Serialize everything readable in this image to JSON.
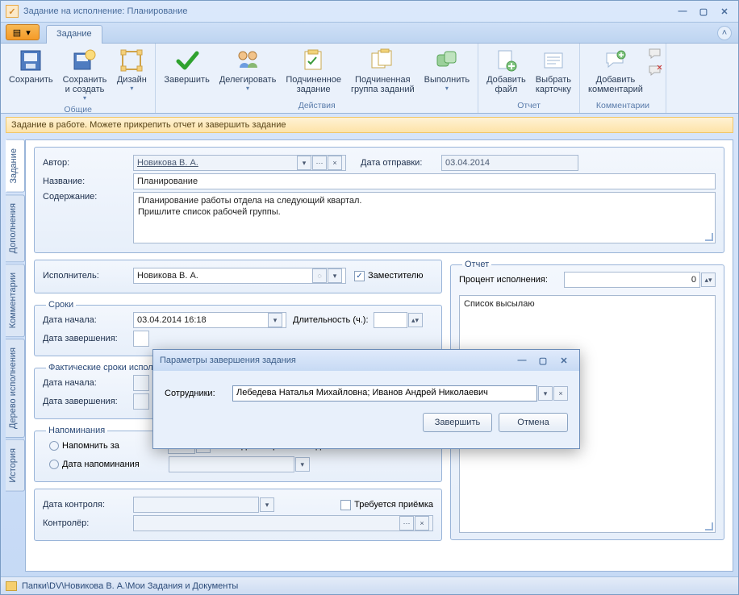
{
  "window": {
    "title": "Задание на исполнение: Планирование"
  },
  "tabs": {
    "main": "Задание"
  },
  "ribbon": {
    "groups": {
      "common": "Общие",
      "actions": "Действия",
      "report": "Отчет",
      "comments": "Комментарии"
    },
    "save": "Сохранить",
    "save_create": "Сохранить\nи создать",
    "design": "Дизайн",
    "finish": "Завершить",
    "delegate": "Делегировать",
    "sub_task": "Подчиненное\nзадание",
    "sub_group": "Подчиненная\nгруппа заданий",
    "execute": "Выполнить",
    "add_file": "Добавить\nфайл",
    "pick_card": "Выбрать\nкарточку",
    "add_comment": "Добавить\nкомментарий"
  },
  "message": "Задание в работе. Можете прикрепить отчет и завершить задание",
  "sidetabs": {
    "task": "Задание",
    "extra": "Дополнения",
    "comments": "Комментарии",
    "tree": "Дерево исполнения",
    "history": "История"
  },
  "form": {
    "author_label": "Автор:",
    "author_value": "Новикова В. А.",
    "sent_label": "Дата отправки:",
    "sent_value": "03.04.2014",
    "name_label": "Название:",
    "name_value": "Планирование",
    "content_label": "Содержание:",
    "content_value": "Планирование работы отдела на следующий квартал.\nПришлите список рабочей группы.",
    "assignee_label": "Исполнитель:",
    "assignee_value": "Новикова В. А.",
    "deputy_label": "Заместителю",
    "dates_legend": "Сроки",
    "start_label": "Дата начала:",
    "start_value": "03.04.2014 16:18",
    "duration_label": "Длительность (ч.):",
    "duration_value": "",
    "end_label": "Дата завершения:",
    "end_value": "",
    "fact_legend": "Фактические сроки исполнения",
    "fact_start_label": "Дата начала:",
    "fact_end_label": "Дата завершения:",
    "remind_legend": "Напоминания",
    "remind_in": "Напомнить за",
    "remind_hours_suffix": "часов до завершения задания",
    "remind_hours_value": "0",
    "remind_date": "Дата напоминания",
    "control_date_label": "Дата контроля:",
    "accept_required_label": "Требуется приёмка",
    "controller_label": "Контролёр:",
    "report_legend": "Отчет",
    "percent_label": "Процент исполнения:",
    "percent_value": "0",
    "report_text": "Список высылаю"
  },
  "status": {
    "path": "Папки\\DV\\Новикова В. А.\\Мои Задания и Документы"
  },
  "dialog": {
    "title": "Параметры завершения задания",
    "employees_label": "Сотрудники:",
    "employees_value": "Лебедева Наталья Михайловна; Иванов Андрей Николаевич",
    "finish": "Завершить",
    "cancel": "Отмена"
  }
}
